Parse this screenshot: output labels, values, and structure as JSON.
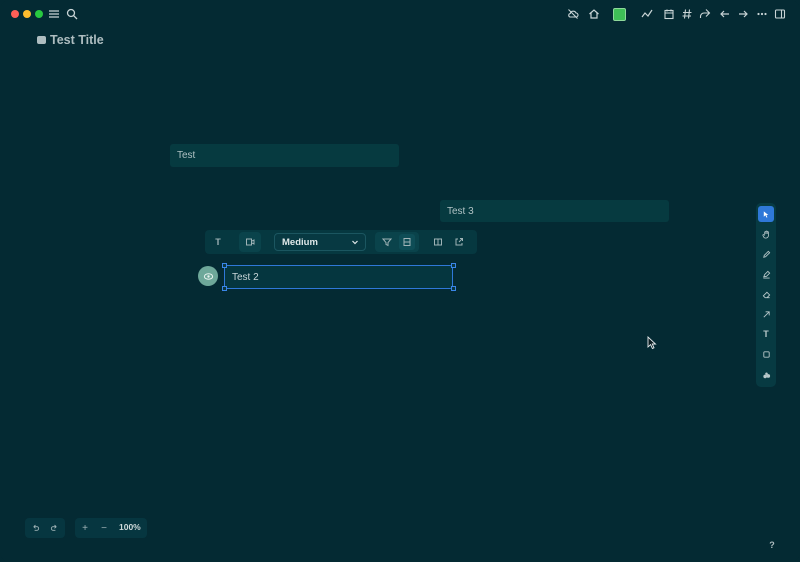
{
  "window": {
    "doc_title": "Test Title",
    "titlebar_icons": [
      "menu-icon",
      "search-icon",
      "cloud-off-icon",
      "home-icon",
      "color-swatch-icon",
      "graph-icon",
      "calendar-icon",
      "hash-icon",
      "share-icon",
      "back-icon",
      "forward-icon",
      "more-icon",
      "sidebar-toggle-icon"
    ],
    "swatch_color": "#3fbf57"
  },
  "canvas": {
    "notes": [
      {
        "label": "Test"
      },
      {
        "label": "Test 3"
      },
      {
        "label": "Test 2"
      }
    ]
  },
  "toolbar": {
    "text_tool_label": "T",
    "size_select_value": "Medium",
    "icons": [
      "text-format-icon",
      "card-icon",
      "chevron-down-icon",
      "filter-icon",
      "grid-icon",
      "split-icon",
      "open-external-icon"
    ]
  },
  "palette": {
    "tools": [
      "select-tool-icon",
      "hand-tool-icon",
      "pen-tool-icon",
      "highlighter-tool-icon",
      "eraser-tool-icon",
      "arrow-tool-icon",
      "text-tool-icon",
      "shape-tool-icon",
      "more-tools-icon"
    ],
    "active_tool": "select-tool-icon",
    "text_tool_label": "T",
    "accent_color": "#2f78d8"
  },
  "footer": {
    "zoom_in_label": "+",
    "zoom_out_label": "−",
    "zoom_level": "100%",
    "help_label": "?"
  }
}
